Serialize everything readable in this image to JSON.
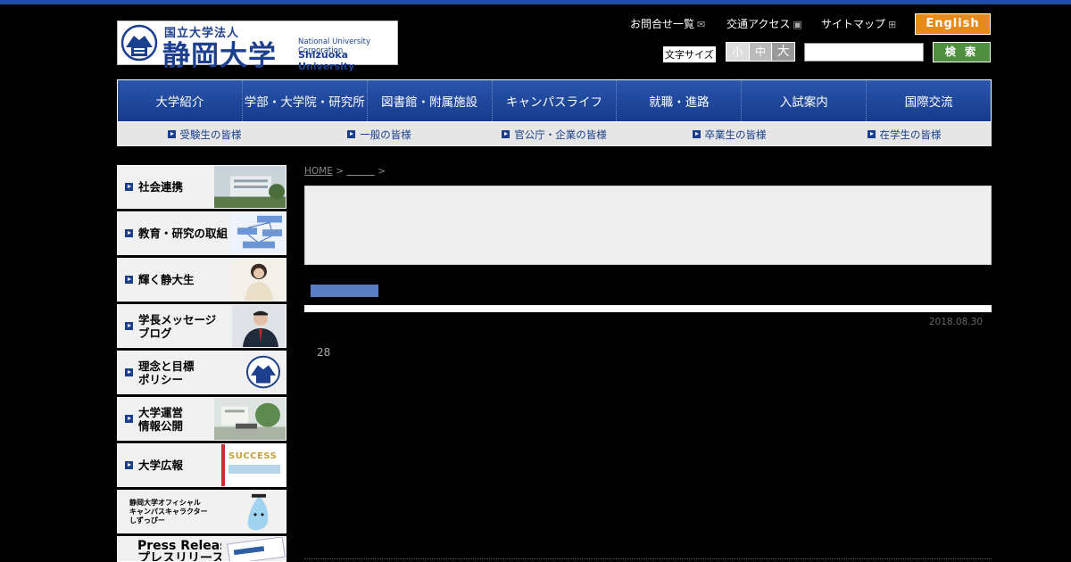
{
  "header": {
    "logo": {
      "ja_small": "国立大学法人",
      "ja_big": "静岡大学",
      "en_line1": "National University Corporation",
      "en_line2": "Shizuoka University"
    },
    "links": {
      "contact": "お問合せ一覧",
      "access": "交通アクセス",
      "sitemap": "サイトマップ"
    },
    "english_label": "English",
    "font_size": {
      "label": "文字サイズ",
      "small": "小",
      "medium": "中",
      "large": "大"
    },
    "search": {
      "value": "",
      "button_label": "検 索"
    }
  },
  "global_nav": [
    {
      "label": "大学紹介"
    },
    {
      "label": "学部・大学院・研究所"
    },
    {
      "label": "図書館・附属施設"
    },
    {
      "label": "キャンパスライフ"
    },
    {
      "label": "就職・進路"
    },
    {
      "label": "入試案内"
    },
    {
      "label": "国際交流"
    }
  ],
  "audience_nav": [
    {
      "label": "受験生の皆様"
    },
    {
      "label": "一般の皆様"
    },
    {
      "label": "官公庁・企業の皆様"
    },
    {
      "label": "卒業生の皆様"
    },
    {
      "label": "在学生の皆様"
    }
  ],
  "sidebar": [
    {
      "label": "社会連携"
    },
    {
      "label": "教育・研究の取組"
    },
    {
      "label": "輝く静大生"
    },
    {
      "label": "学長メッセージ\nブログ"
    },
    {
      "label": "理念と目標\nポリシー"
    },
    {
      "label": "大学運営\n情報公開"
    },
    {
      "label": "大学広報",
      "thumb_text": "SUCCESS"
    },
    {
      "label": "静岡大学オフィシャル\nキャンパスキャラクター\nしずっぴー"
    },
    {
      "label": "Press Release\nプレスリリース"
    }
  ],
  "breadcrumb": {
    "home": "HOME",
    "sep": ">",
    "current": "　　　"
  },
  "post": {
    "date": "2018.08.30",
    "body": "28"
  },
  "colors": {
    "brand_blue": "#163d8f",
    "english_orange": "#e68a1c",
    "search_green": "#4d8f3c"
  }
}
